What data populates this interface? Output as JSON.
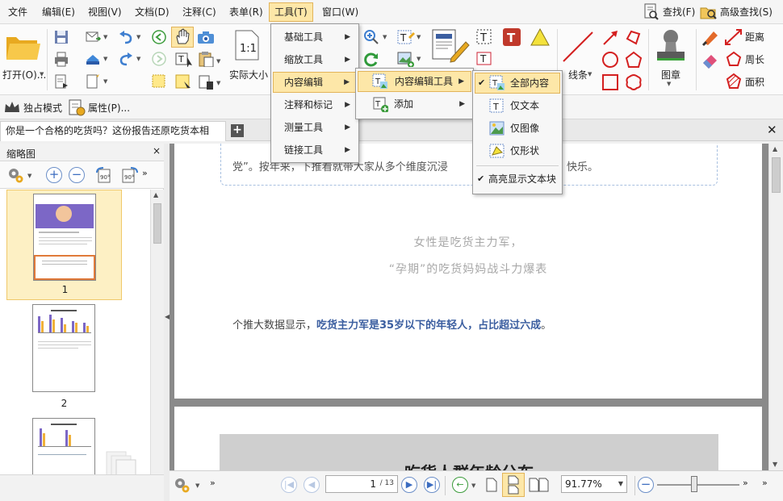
{
  "menubar": {
    "items": [
      "文件",
      "编辑(E)",
      "视图(V)",
      "文档(D)",
      "注释(C)",
      "表单(R)",
      "工具(T)",
      "窗口(W)"
    ],
    "find": "查找(F)",
    "advanced_find": "高级查找(S)"
  },
  "ribbon": {
    "open": "打开(O)...",
    "actual_size": "实际大小",
    "lines": "线条",
    "stamp": "图章",
    "distance": "距离",
    "perimeter": "周长",
    "area": "面积"
  },
  "quickbar": {
    "exclusive_mode": "独占模式",
    "properties": "属性(P)..."
  },
  "tab": {
    "title": "你是一个合格的吃货吗？这份报告还原吃货本相"
  },
  "panel": {
    "title": "缩略图",
    "pages": [
      "1",
      "2"
    ]
  },
  "document": {
    "line1": "党”。按年来，下推看就带大家从多个维度沉浸",
    "line1_tail": "快乐。",
    "heading1": "女性是吃货主力军，",
    "heading2": "“孕期”的吃货妈妈战斗力爆表",
    "para_prefix": "个推大数据显示，",
    "para_highlight": "吃货主力军是35岁以下的年轻人，占比超过六成",
    "para_suffix": "。",
    "page2_title": "吃货人群年龄分布"
  },
  "tools_menu": {
    "items": [
      "基础工具",
      "缩放工具",
      "内容编辑",
      "注释和标记",
      "测量工具",
      "链接工具"
    ]
  },
  "content_edit_menu": {
    "items": [
      "内容编辑工具",
      "添加"
    ]
  },
  "edit_tools_menu": {
    "items": [
      "全部内容",
      "仅文本",
      "仅图像",
      "仅形状"
    ],
    "highlight": "高亮显示文本块"
  },
  "statusbar": {
    "page_current": "1",
    "page_total": "/ 13",
    "zoom": "91.77%"
  }
}
